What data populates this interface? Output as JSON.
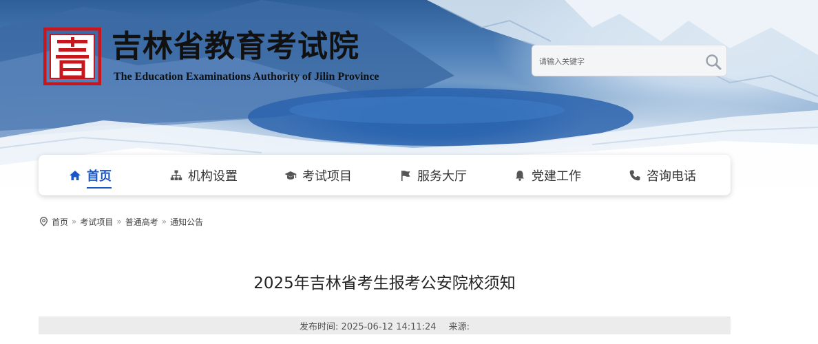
{
  "header": {
    "title": "吉林省教育考试院",
    "subtitle": "The Education Examinations Authority of Jilin Province",
    "logo_icon": "seal-logo-icon",
    "logo_color": "#c8161d"
  },
  "search": {
    "placeholder": "请输入关键字",
    "icon": "search-icon"
  },
  "nav": {
    "accent": "#1a56c9",
    "items": [
      {
        "label": "首页",
        "icon": "home-icon",
        "active": true
      },
      {
        "label": "机构设置",
        "icon": "org-chart-icon",
        "active": false
      },
      {
        "label": "考试项目",
        "icon": "graduation-cap-icon",
        "active": false
      },
      {
        "label": "服务大厅",
        "icon": "flag-icon",
        "active": false
      },
      {
        "label": "党建工作",
        "icon": "bell-icon",
        "active": false
      },
      {
        "label": "咨询电话",
        "icon": "phone-icon",
        "active": false
      }
    ]
  },
  "breadcrumb": {
    "icon": "location-pin-icon",
    "items": [
      "首页",
      "考试项目",
      "普通高考",
      "通知公告"
    ],
    "separator": "»"
  },
  "article": {
    "title": "2025年吉林省考生报考公安院校须知",
    "published_label": "发布时间: 2025-06-12 14:11:24",
    "source_label": "来源:"
  }
}
